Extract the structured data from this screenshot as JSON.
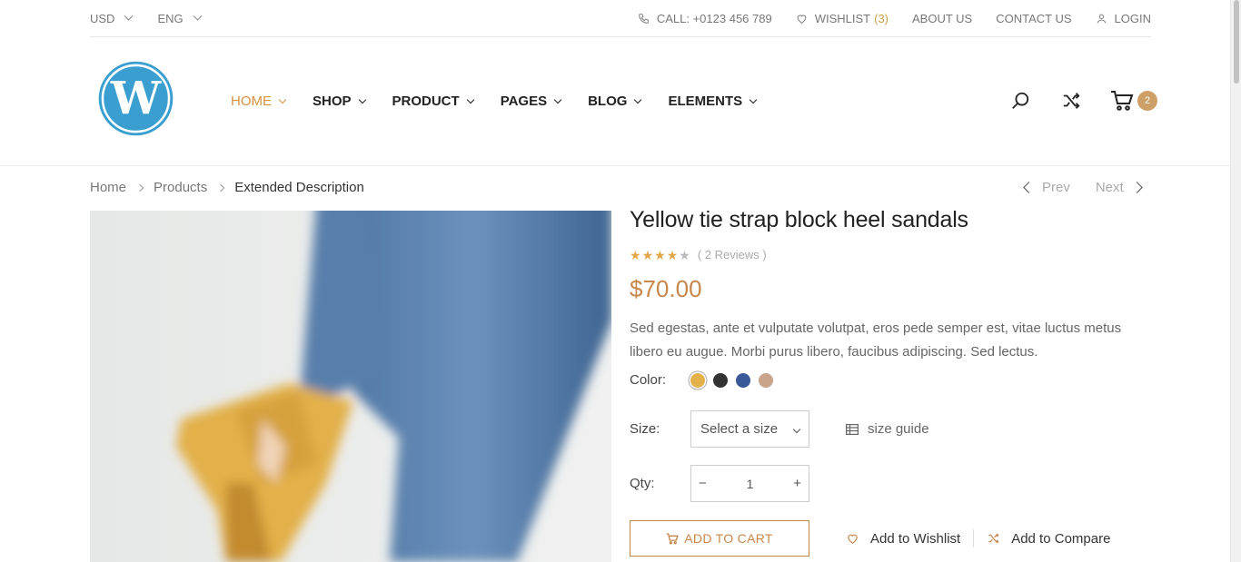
{
  "topbar": {
    "currency": "USD",
    "language": "ENG",
    "call": "CALL: +0123 456 789",
    "wishlist_label": "WISHLIST",
    "wishlist_count": "(3)",
    "about": "ABOUT US",
    "contact": "CONTACT US",
    "login": "LOGIN"
  },
  "nav": {
    "items": [
      {
        "label": "HOME"
      },
      {
        "label": "SHOP"
      },
      {
        "label": "PRODUCT"
      },
      {
        "label": "PAGES"
      },
      {
        "label": "BLOG"
      },
      {
        "label": "ELEMENTS"
      }
    ]
  },
  "header": {
    "cart_count": "2"
  },
  "breadcrumb": {
    "home": "Home",
    "products": "Products",
    "current": "Extended Description"
  },
  "pager": {
    "prev": "Prev",
    "next": "Next"
  },
  "product": {
    "title": "Yellow tie strap block heel sandals",
    "rating": 4,
    "rating_max": 5,
    "reviews": "( 2 Reviews )",
    "price": "$70.00",
    "description": "Sed egestas, ante et vulputate volutpat, eros pede semper est, vitae luctus metus libero eu augue. Morbi purus libero, faucibus adipiscing. Sed lectus.",
    "color_label": "Color:",
    "colors": [
      "#e3b04a",
      "#333333",
      "#3b5998",
      "#c9a38a"
    ],
    "size_label": "Size:",
    "size_placeholder": "Select a size",
    "size_guide": "size guide",
    "qty_label": "Qty:",
    "qty_minus": "−",
    "qty_value": "1",
    "qty_plus": "+",
    "add_to_cart": "ADD TO CART",
    "add_to_wishlist": "Add to Wishlist",
    "add_to_compare": "Add to Compare"
  },
  "colors": {
    "accent": "#c8874a",
    "nav_active": "#d6923f",
    "logo": "#3a9fd0"
  }
}
